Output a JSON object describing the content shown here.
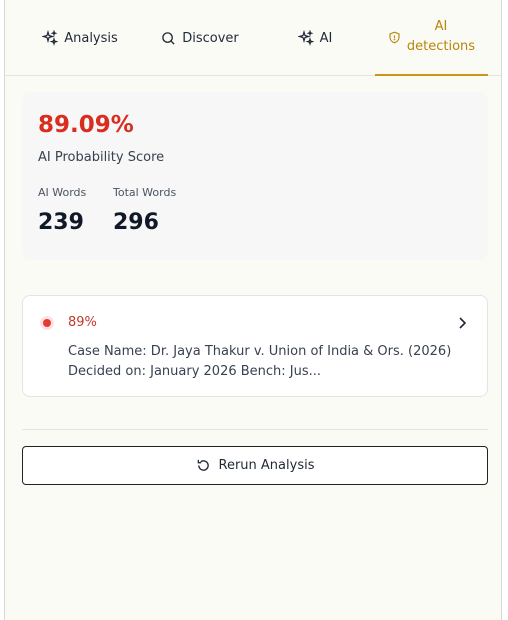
{
  "tabs": [
    {
      "label": "Analysis",
      "icon": "sparkles-icon",
      "active": false
    },
    {
      "label": "Discover",
      "icon": "search-icon",
      "active": false
    },
    {
      "label": "AI",
      "icon": "sparkles-icon",
      "active": false
    },
    {
      "label_line1": "AI",
      "label_line2": "detections",
      "icon": "shield-icon",
      "active": true
    }
  ],
  "score": {
    "value": "89.09%",
    "label": "AI Probability Score",
    "ai_words_label": "AI Words",
    "ai_words": "239",
    "total_words_label": "Total Words",
    "total_words": "296"
  },
  "result": {
    "percent": "89%",
    "description": "Case Name: Dr. Jaya Thakur v. Union of India & Ors. (2026) Decided on: January 2026 Bench: Jus..."
  },
  "rerun_label": "Rerun Analysis",
  "colors": {
    "accent": "#c9961a",
    "danger": "#d92d20"
  }
}
